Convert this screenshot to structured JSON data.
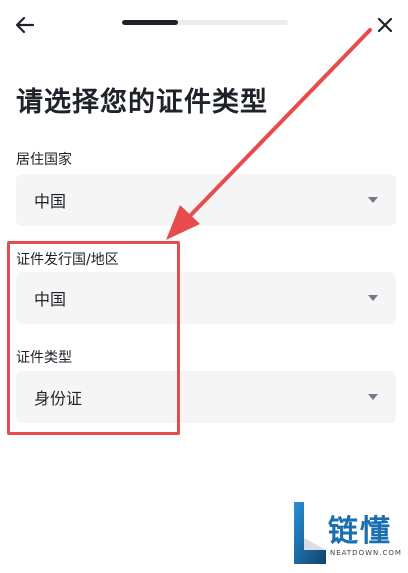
{
  "header": {
    "back_icon": "arrow-left-icon",
    "close_icon": "close-icon",
    "progress": 0.34
  },
  "title": "请选择您的证件类型",
  "fields": [
    {
      "label": "居住国家",
      "value": "中国"
    },
    {
      "label": "证件发行国/地区",
      "value": "中国"
    },
    {
      "label": "证件类型",
      "value": "身份证"
    }
  ],
  "annotation": {
    "color": "#e74c4c"
  },
  "watermark": {
    "text": "链懂",
    "sub": "NEATDOWN.COM"
  }
}
